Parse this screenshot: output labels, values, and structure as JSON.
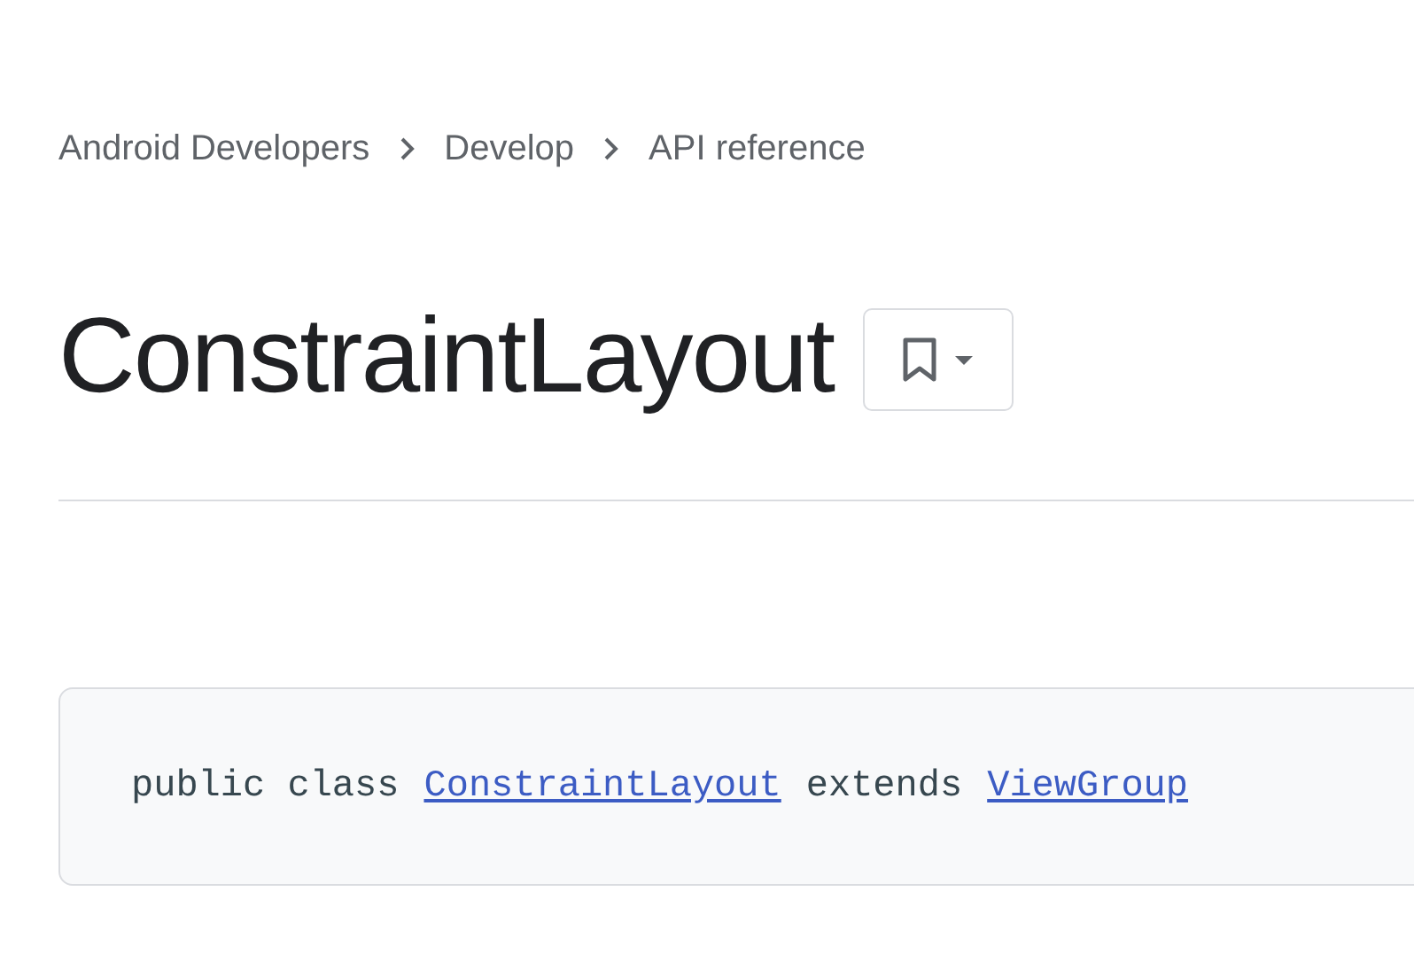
{
  "breadcrumbs": [
    "Android Developers",
    "Develop",
    "API reference"
  ],
  "title": "ConstraintLayout",
  "signature": [
    {
      "kind": "text",
      "text": "public class"
    },
    {
      "kind": "link",
      "text": "ConstraintLayout"
    },
    {
      "kind": "text",
      "text": "extends"
    },
    {
      "kind": "link",
      "text": "ViewGroup"
    }
  ]
}
